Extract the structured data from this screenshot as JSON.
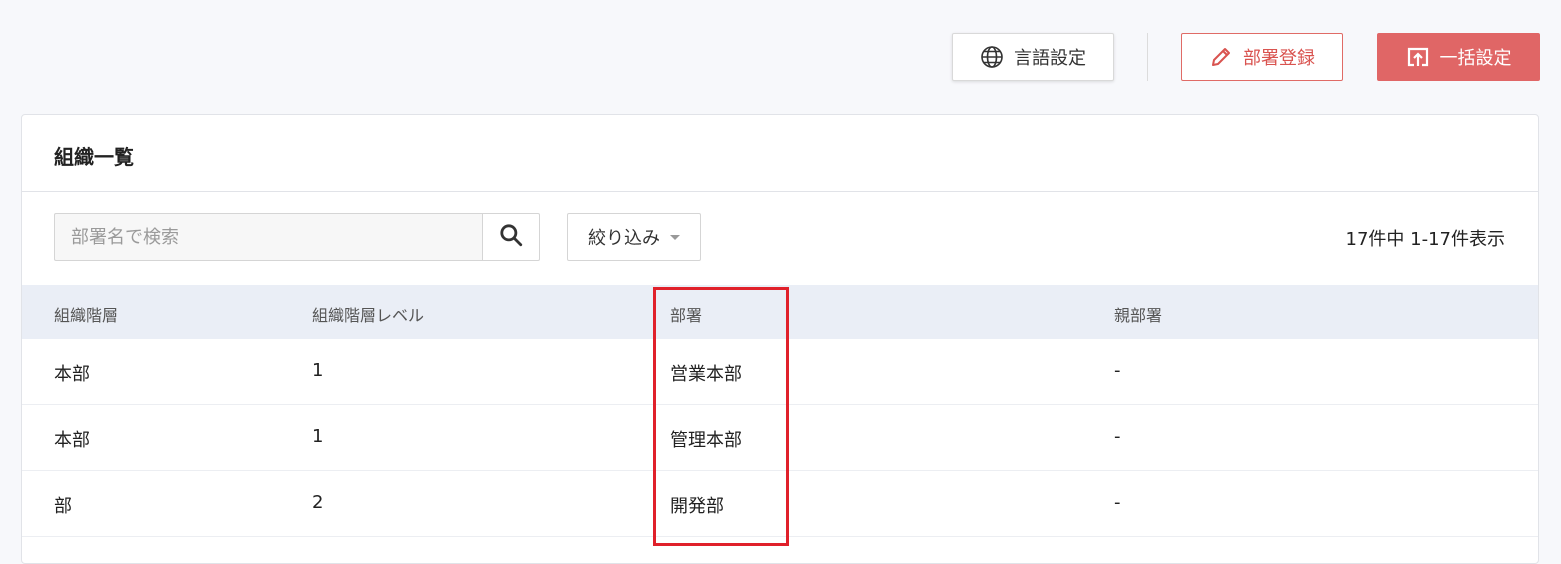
{
  "toolbar": {
    "lang_label": "言語設定",
    "register_label": "部署登録",
    "bulk_label": "一括設定"
  },
  "card": {
    "title": "組織一覧"
  },
  "search": {
    "placeholder": "部署名で検索"
  },
  "filter": {
    "label": "絞り込み"
  },
  "result_count": "17件中 1-17件表示",
  "table": {
    "headers": [
      "組織階層",
      "組織階層レベル",
      "部署",
      "親部署"
    ],
    "rows": [
      [
        "本部",
        "1",
        "営業本部",
        "-"
      ],
      [
        "本部",
        "1",
        "管理本部",
        "-"
      ],
      [
        "部",
        "2",
        "開発部",
        "-"
      ]
    ]
  },
  "colors": {
    "accent_red": "#e06666",
    "highlight_red": "#e0202a",
    "header_bg": "#eaeef6"
  },
  "icons": {
    "lang": "globe-icon",
    "register": "pencil-icon",
    "bulk": "upload-icon",
    "search": "search-icon",
    "filter": "caret-down-icon"
  }
}
